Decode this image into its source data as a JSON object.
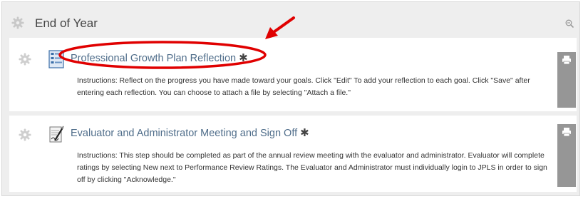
{
  "section": {
    "title": "End of Year"
  },
  "items": [
    {
      "title": "Professional Growth Plan Reflection",
      "required_mark": "✱",
      "instructions": "Instructions: Reflect on the progress you have made toward your goals. Click \"Edit\" To add your reflection to each goal. Click \"Save\" after entering each reflection. You can choose to attach a file by selecting \"Attach a file.\"",
      "highlighted": true
    },
    {
      "title": "Evaluator and Administrator Meeting and Sign Off",
      "required_mark": "✱",
      "instructions": "Instructions: This step should be completed as part of the annual review meeting with the evaluator and administrator. Evaluator will complete ratings by selecting New next to Performance Review Ratings. The Evaluator and Administrator must individually login to JPLS in order to sign off by clicking \"Acknowledge.\"",
      "highlighted": false
    }
  ],
  "icons": {
    "section": "gear-icon",
    "zoom": "zoom-out-icon",
    "item1": "form-document-icon",
    "item2": "signature-document-icon",
    "print": "print-icon"
  },
  "colors": {
    "panel_bg": "#eeeeee",
    "card_bg": "#ffffff",
    "link": "#4f6d8a",
    "print_tab": "#969696",
    "annotation": "#e00000"
  }
}
